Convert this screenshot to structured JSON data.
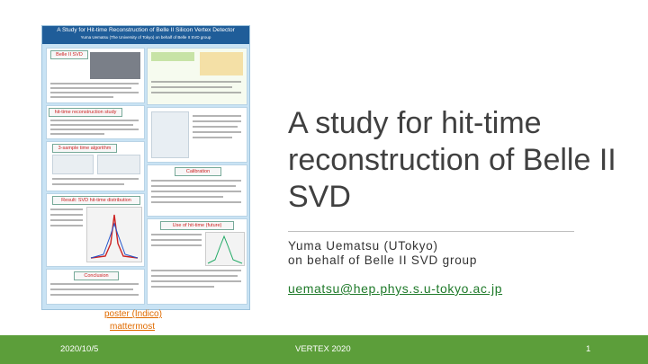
{
  "poster": {
    "title": "A Study for Hit-time Reconstruction of Belle II Silicon Vertex Detector",
    "subtitle": "Yuma Uematsu (The University of Tokyo) on behalf of Belle II SVD group",
    "sections": [
      "Belle II SVD",
      "hit-time reconstruction study",
      "3-sample time algorithm",
      "Result: SVD hit-time distribution",
      "Calibration",
      "Use of hit-time (future)",
      "Conclusion"
    ]
  },
  "title": "A study for hit-time reconstruction of Belle II SVD",
  "author_line1": "Yuma Uematsu (UTokyo)",
  "author_line2": "on behalf of Belle II SVD group",
  "email": "uematsu@hep.phys.s.u-tokyo.ac.jp",
  "links": {
    "poster": "poster (Indico)",
    "mattermost": "mattermost"
  },
  "footer": {
    "date": "2020/10/5",
    "conference": "VERTEX 2020",
    "page": "1"
  },
  "colors": {
    "footer_bg": "#5c9e3a",
    "link": "#e06b00",
    "email": "#1f7a2a",
    "poster_bg": "#c9e3f4"
  }
}
